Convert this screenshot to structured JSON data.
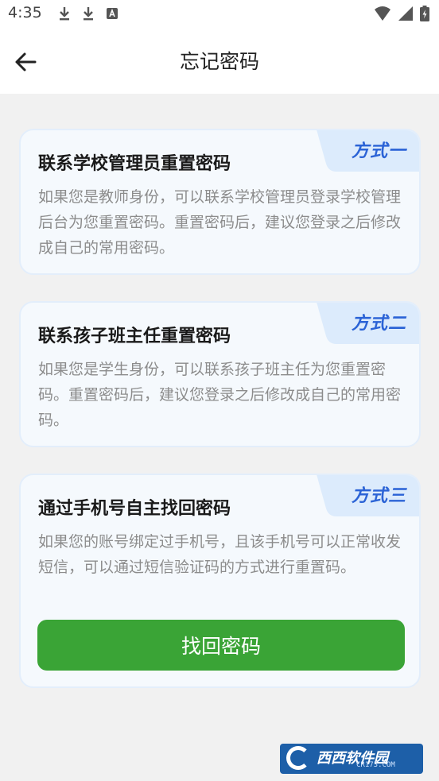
{
  "status_bar": {
    "time": "4:35",
    "left_icons": [
      "download-icon",
      "download-icon",
      "a-icon"
    ],
    "right_icons": [
      "wifi-icon",
      "signal-icon",
      "battery-icon"
    ]
  },
  "header": {
    "title": "忘记密码",
    "back_icon": "arrow-left-icon"
  },
  "methods": [
    {
      "tag": "方式一",
      "title": "联系学校管理员重置密码",
      "description": "如果您是教师身份，可以联系学校管理员登录学校管理后台为您重置密码。重置密码后，建议您登录之后修改成自己的常用密码。"
    },
    {
      "tag": "方式二",
      "title": "联系孩子班主任重置密码",
      "description": "如果您是学生身份，可以联系孩子班主任为您重置密码。重置密码后，建议您登录之后修改成自己的常用密码。"
    },
    {
      "tag": "方式三",
      "title": "通过手机号自主找回密码",
      "description": "如果您的账号绑定过手机号，且该手机号可以正常收发短信，可以通过短信验证码的方式进行重置码。",
      "button_label": "找回密码"
    }
  ],
  "watermark": {
    "text": "西西软件园",
    "sub": "CR173.COM"
  },
  "colors": {
    "accent_green": "#3aa436",
    "tag_blue": "#2b63d6",
    "card_bg": "#f5f9fd",
    "tab_bg": "#dcebfc"
  }
}
